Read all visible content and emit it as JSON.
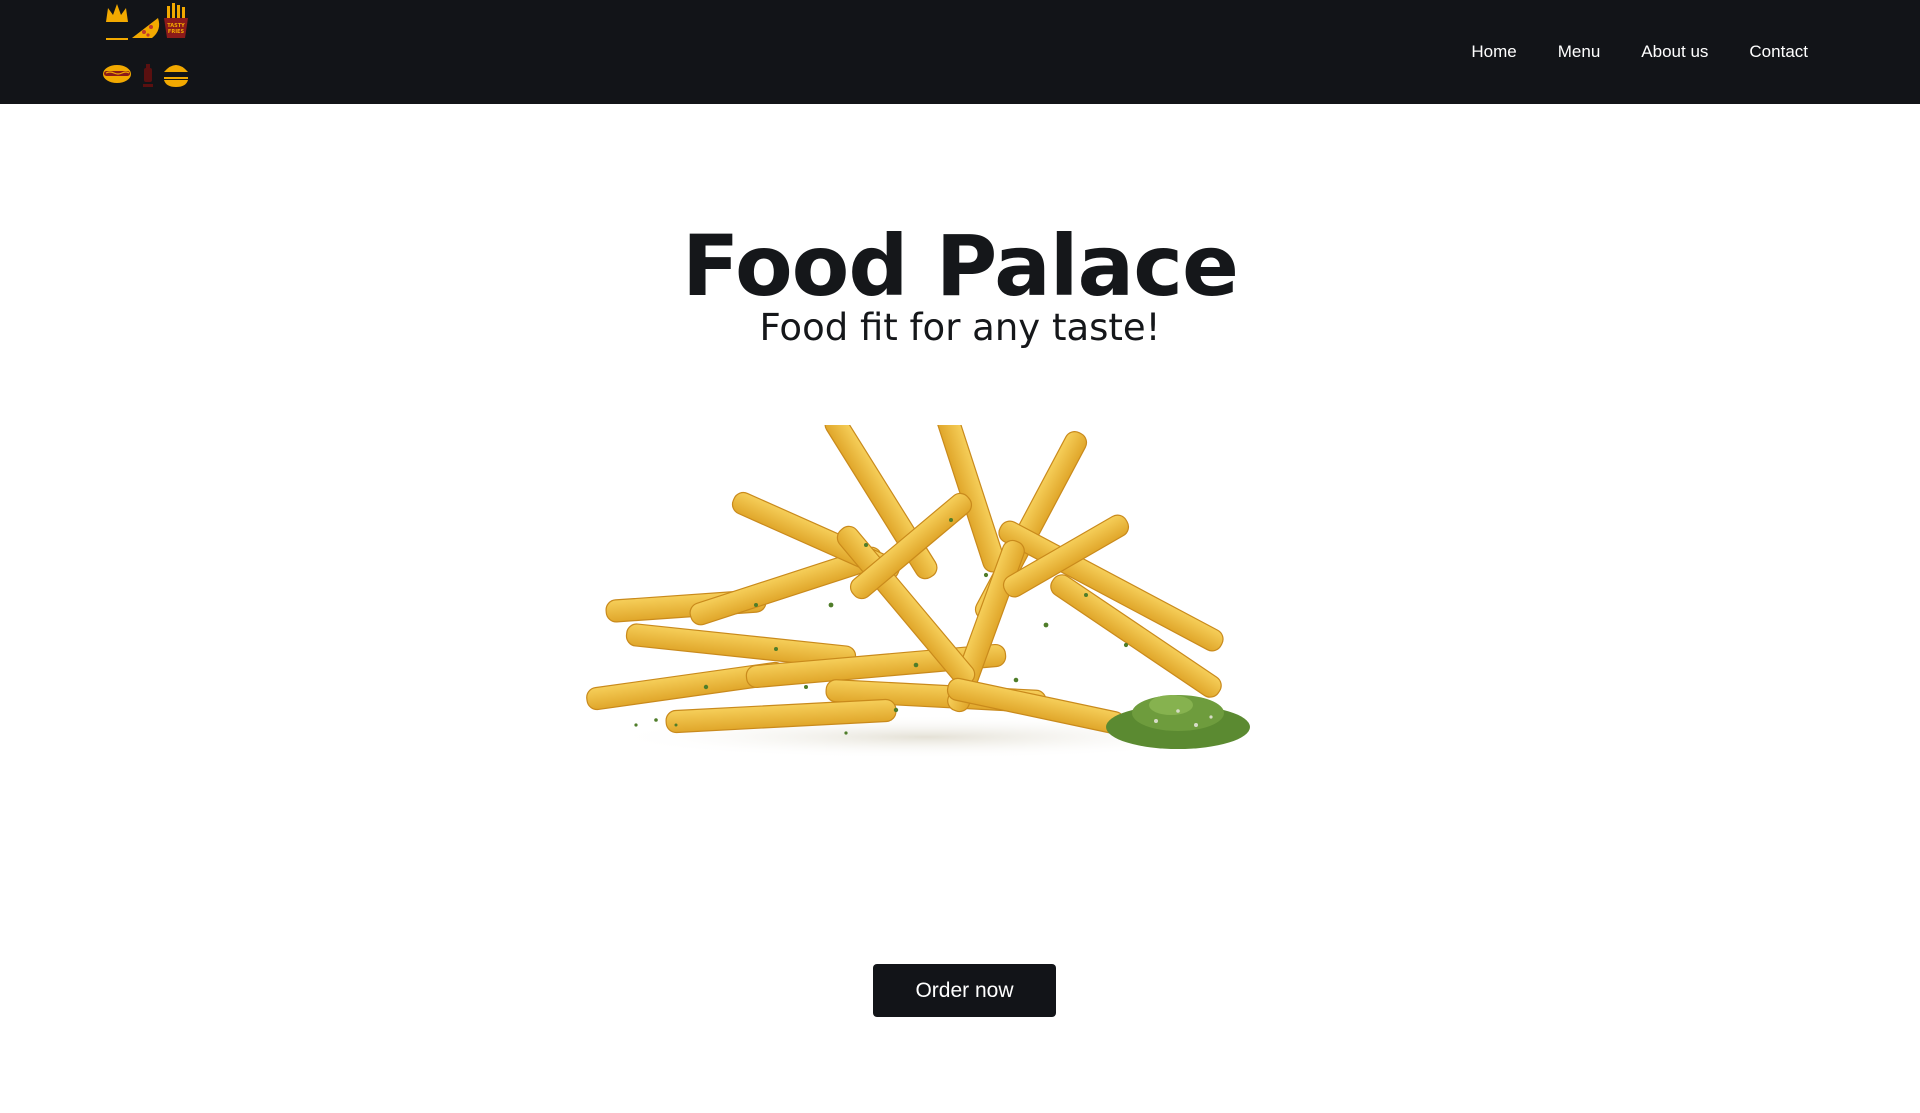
{
  "brand": {
    "logo_icons": [
      "crown-icon",
      "pizza-slice-icon",
      "fries-box-icon",
      "hotdog-icon",
      "ketchup-icon",
      "burger-icon"
    ],
    "logo_text": "TASTY FRIES",
    "accent_color": "#f2a900"
  },
  "nav": {
    "items": [
      {
        "label": "Home"
      },
      {
        "label": "Menu"
      },
      {
        "label": "About us"
      },
      {
        "label": "Contact"
      }
    ]
  },
  "hero": {
    "title": "Food Palace",
    "subtitle": "Food fit for any taste!",
    "image": "french-fries-image",
    "cta_label": "Order now"
  },
  "colors": {
    "navbar_bg": "#121418",
    "page_bg": "#ffffff",
    "text": "#15171a",
    "button_bg": "#121418",
    "button_text": "#ffffff"
  }
}
